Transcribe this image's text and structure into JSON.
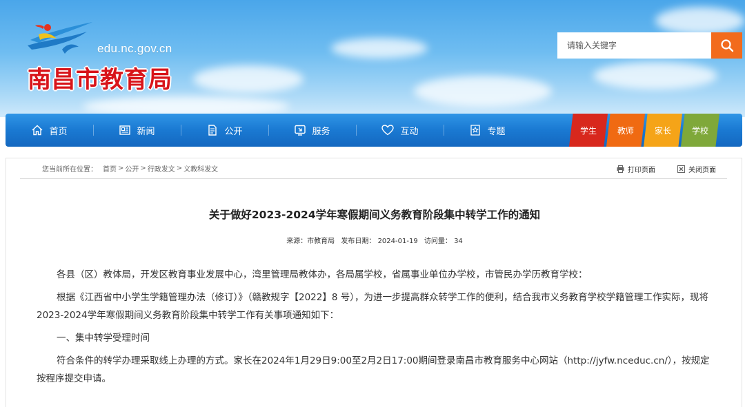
{
  "header": {
    "domain": "edu.nc.gov.cn",
    "site_title": "南昌市教育局",
    "search_placeholder": "请输入关键字"
  },
  "nav": {
    "items": [
      {
        "label": "首页",
        "icon": "home-icon"
      },
      {
        "label": "新闻",
        "icon": "newspaper-icon"
      },
      {
        "label": "公开",
        "icon": "document-icon"
      },
      {
        "label": "服务",
        "icon": "service-icon"
      },
      {
        "label": "互动",
        "icon": "heart-icon"
      },
      {
        "label": "专题",
        "icon": "star-icon"
      }
    ],
    "roles": [
      {
        "label": "学生",
        "color": "#d8281d"
      },
      {
        "label": "教师",
        "color": "#f06a12"
      },
      {
        "label": "家长",
        "color": "#f5a418"
      },
      {
        "label": "学校",
        "color": "#7fa83a"
      }
    ]
  },
  "breadcrumb": {
    "label": "您当前所在位置：",
    "items": [
      "首页",
      "公开",
      "行政发文",
      "义教科发文"
    ],
    "separator": ">"
  },
  "tools": {
    "print": "打印页面",
    "close": "关闭页面"
  },
  "article": {
    "title": "关于做好2023-2024学年寒假期间义务教育阶段集中转学工作的通知",
    "meta": {
      "source_label": "来源：",
      "source": "市教育局",
      "date_label": "发布日期：",
      "date": "2024-01-19",
      "visits_label": "访问量：",
      "visits": "34"
    },
    "paragraphs": [
      "各县（区）教体局，开发区教育事业发展中心，湾里管理局教体办，各局属学校，省属事业单位办学校，市管民办学历教育学校：",
      "根据《江西省中小学生学籍管理办法（修订）》（赣教规字【2022】8 号），为进一步提高群众转学工作的便利，结合我市义务教育学校学籍管理工作实际，现将2023-2024学年寒假期间义务教育阶段集中转学工作有关事项通知如下：",
      "一、集中转学受理时间",
      "符合条件的转学办理采取线上办理的方式。家长在2024年1月29日9:00至2月2日17:00期间登录南昌市教育服务中心网站（http://jyfw.nceduc.cn/），按规定按程序提交申请。"
    ]
  }
}
